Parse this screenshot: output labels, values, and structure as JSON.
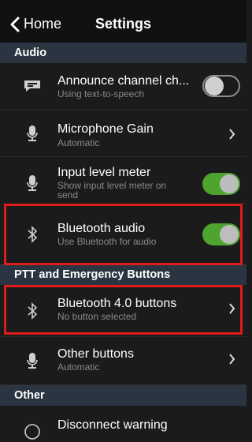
{
  "navbar": {
    "back_label": "Home",
    "title": "Settings"
  },
  "sections": [
    {
      "label": "Audio"
    },
    {
      "label": "PTT and Emergency Buttons"
    },
    {
      "label": "Other"
    }
  ],
  "rows": [
    {
      "title": "Announce channel ch...",
      "subtitle": "Using text-to-speech",
      "icon": "speech-bubble-icon",
      "control": "toggle",
      "value": "off"
    },
    {
      "title": "Microphone Gain",
      "subtitle": "Automatic",
      "icon": "microphone-icon",
      "control": "chevron"
    },
    {
      "title": "Input level meter",
      "subtitle": "Show input level meter on send",
      "icon": "microphone-icon",
      "control": "toggle",
      "value": "on"
    },
    {
      "title": "Bluetooth audio",
      "subtitle": "Use Bluetooth for audio",
      "icon": "bluetooth-icon",
      "control": "toggle",
      "value": "on"
    },
    {
      "title": "Bluetooth 4.0 buttons",
      "subtitle": "No button selected",
      "icon": "bluetooth-icon",
      "control": "chevron"
    },
    {
      "title": "Other buttons",
      "subtitle": "Automatic",
      "icon": "microphone-icon",
      "control": "chevron"
    },
    {
      "title": "Disconnect warning",
      "subtitle": "",
      "icon": "",
      "control": ""
    }
  ],
  "colors": {
    "toggle_on": "#4fa42f",
    "highlight": "#e01b1b",
    "section_bg": "#2b3542"
  }
}
